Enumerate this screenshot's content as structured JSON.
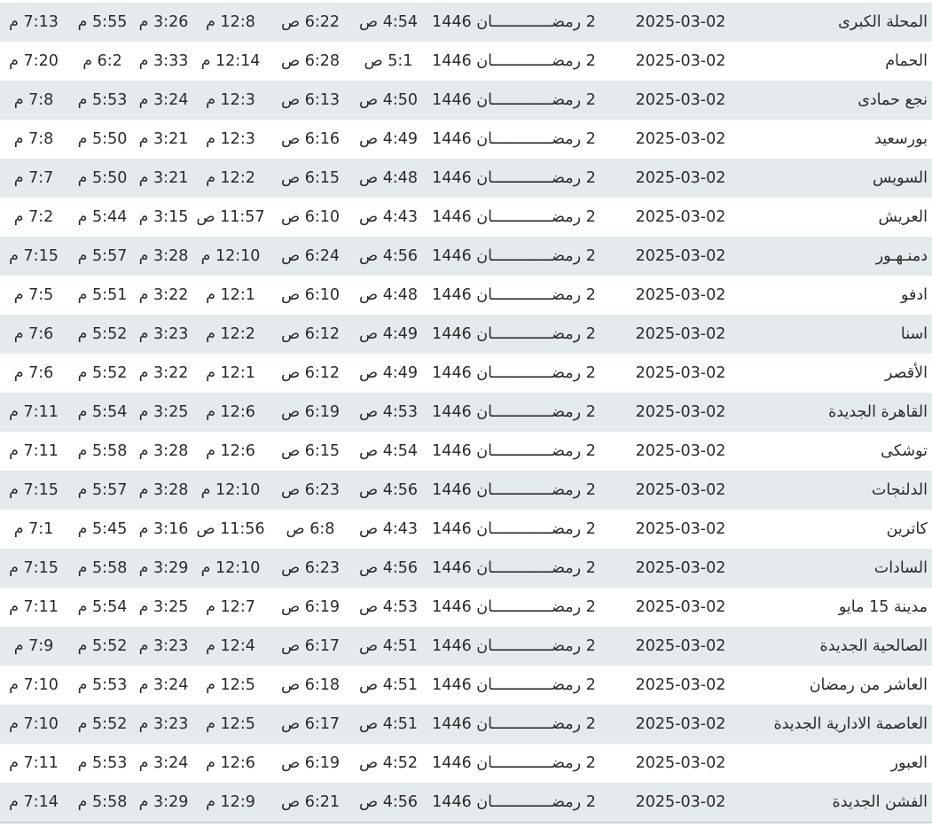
{
  "rows": [
    {
      "city": "المحلة الكبرى",
      "date": "2025-03-02",
      "hijri": "2 رمضـــــــــــــان 1446",
      "fajr": "4:54 ص",
      "sunrise": "6:22 ص",
      "dhuhr": "12:8 م",
      "asr": "3:26 م",
      "maghrib": "5:55 م",
      "isha": "7:13 م"
    },
    {
      "city": "الحمام",
      "date": "2025-03-02",
      "hijri": "2 رمضـــــــــــــان 1446",
      "fajr": "5:1 ص",
      "sunrise": "6:28 ص",
      "dhuhr": "12:14 م",
      "asr": "3:33 م",
      "maghrib": "6:2 م",
      "isha": "7:20 م"
    },
    {
      "city": "نجع حمادى",
      "date": "2025-03-02",
      "hijri": "2 رمضـــــــــــــان 1446",
      "fajr": "4:50 ص",
      "sunrise": "6:13 ص",
      "dhuhr": "12:3 م",
      "asr": "3:24 م",
      "maghrib": "5:53 م",
      "isha": "7:8 م"
    },
    {
      "city": "بورسعيد",
      "date": "2025-03-02",
      "hijri": "2 رمضـــــــــــــان 1446",
      "fajr": "4:49 ص",
      "sunrise": "6:16 ص",
      "dhuhr": "12:3 م",
      "asr": "3:21 م",
      "maghrib": "5:50 م",
      "isha": "7:8 م"
    },
    {
      "city": "السويس",
      "date": "2025-03-02",
      "hijri": "2 رمضـــــــــــــان 1446",
      "fajr": "4:48 ص",
      "sunrise": "6:15 ص",
      "dhuhr": "12:2 م",
      "asr": "3:21 م",
      "maghrib": "5:50 م",
      "isha": "7:7 م"
    },
    {
      "city": "العريش",
      "date": "2025-03-02",
      "hijri": "2 رمضـــــــــــــان 1446",
      "fajr": "4:43 ص",
      "sunrise": "6:10 ص",
      "dhuhr": "11:57 ص",
      "asr": "3:15 م",
      "maghrib": "5:44 م",
      "isha": "7:2 م"
    },
    {
      "city": "دمنـهـور",
      "date": "2025-03-02",
      "hijri": "2 رمضـــــــــــــان 1446",
      "fajr": "4:56 ص",
      "sunrise": "6:24 ص",
      "dhuhr": "12:10 م",
      "asr": "3:28 م",
      "maghrib": "5:57 م",
      "isha": "7:15 م"
    },
    {
      "city": "ادفو",
      "date": "2025-03-02",
      "hijri": "2 رمضـــــــــــــان 1446",
      "fajr": "4:48 ص",
      "sunrise": "6:10 ص",
      "dhuhr": "12:1 م",
      "asr": "3:22 م",
      "maghrib": "5:51 م",
      "isha": "7:5 م"
    },
    {
      "city": "اسنا",
      "date": "2025-03-02",
      "hijri": "2 رمضـــــــــــــان 1446",
      "fajr": "4:49 ص",
      "sunrise": "6:12 ص",
      "dhuhr": "12:2 م",
      "asr": "3:23 م",
      "maghrib": "5:52 م",
      "isha": "7:6 م"
    },
    {
      "city": "الأقصر",
      "date": "2025-03-02",
      "hijri": "2 رمضـــــــــــــان 1446",
      "fajr": "4:49 ص",
      "sunrise": "6:12 ص",
      "dhuhr": "12:1 م",
      "asr": "3:22 م",
      "maghrib": "5:52 م",
      "isha": "7:6 م"
    },
    {
      "city": "القاهرة الجديدة",
      "date": "2025-03-02",
      "hijri": "2 رمضـــــــــــــان 1446",
      "fajr": "4:53 ص",
      "sunrise": "6:19 ص",
      "dhuhr": "12:6 م",
      "asr": "3:25 م",
      "maghrib": "5:54 م",
      "isha": "7:11 م"
    },
    {
      "city": "توشكى",
      "date": "2025-03-02",
      "hijri": "2 رمضـــــــــــــان 1446",
      "fajr": "4:54 ص",
      "sunrise": "6:15 ص",
      "dhuhr": "12:6 م",
      "asr": "3:28 م",
      "maghrib": "5:58 م",
      "isha": "7:11 م"
    },
    {
      "city": "الدلنجات",
      "date": "2025-03-02",
      "hijri": "2 رمضـــــــــــــان 1446",
      "fajr": "4:56 ص",
      "sunrise": "6:23 ص",
      "dhuhr": "12:10 م",
      "asr": "3:28 م",
      "maghrib": "5:57 م",
      "isha": "7:15 م"
    },
    {
      "city": "كاترين",
      "date": "2025-03-02",
      "hijri": "2 رمضـــــــــــــان 1446",
      "fajr": "4:43 ص",
      "sunrise": "6:8 ص",
      "dhuhr": "11:56 ص",
      "asr": "3:16 م",
      "maghrib": "5:45 م",
      "isha": "7:1 م"
    },
    {
      "city": "السادات",
      "date": "2025-03-02",
      "hijri": "2 رمضـــــــــــــان 1446",
      "fajr": "4:56 ص",
      "sunrise": "6:23 ص",
      "dhuhr": "12:10 م",
      "asr": "3:29 م",
      "maghrib": "5:58 م",
      "isha": "7:15 م"
    },
    {
      "city": "مدينة 15 مايو",
      "date": "2025-03-02",
      "hijri": "2 رمضـــــــــــــان 1446",
      "fajr": "4:53 ص",
      "sunrise": "6:19 ص",
      "dhuhr": "12:7 م",
      "asr": "3:25 م",
      "maghrib": "5:54 م",
      "isha": "7:11 م"
    },
    {
      "city": "الصالحية الجديدة",
      "date": "2025-03-02",
      "hijri": "2 رمضـــــــــــــان 1446",
      "fajr": "4:51 ص",
      "sunrise": "6:17 ص",
      "dhuhr": "12:4 م",
      "asr": "3:23 م",
      "maghrib": "5:52 م",
      "isha": "7:9 م"
    },
    {
      "city": "العاشر من رمضان",
      "date": "2025-03-02",
      "hijri": "2 رمضـــــــــــــان 1446",
      "fajr": "4:51 ص",
      "sunrise": "6:18 ص",
      "dhuhr": "12:5 م",
      "asr": "3:24 م",
      "maghrib": "5:53 م",
      "isha": "7:10 م"
    },
    {
      "city": "العاصمة الادارية الجديدة",
      "date": "2025-03-02",
      "hijri": "2 رمضـــــــــــــان 1446",
      "fajr": "4:51 ص",
      "sunrise": "6:17 ص",
      "dhuhr": "12:5 م",
      "asr": "3:23 م",
      "maghrib": "5:52 م",
      "isha": "7:10 م"
    },
    {
      "city": "العبور",
      "date": "2025-03-02",
      "hijri": "2 رمضـــــــــــــان 1446",
      "fajr": "4:52 ص",
      "sunrise": "6:19 ص",
      "dhuhr": "12:6 م",
      "asr": "3:24 م",
      "maghrib": "5:53 م",
      "isha": "7:11 م"
    },
    {
      "city": "الفشن الجديدة",
      "date": "2025-03-02",
      "hijri": "2 رمضـــــــــــــان 1446",
      "fajr": "4:56 ص",
      "sunrise": "6:21 ص",
      "dhuhr": "12:9 م",
      "asr": "3:29 م",
      "maghrib": "5:58 م",
      "isha": "7:14 م"
    }
  ]
}
